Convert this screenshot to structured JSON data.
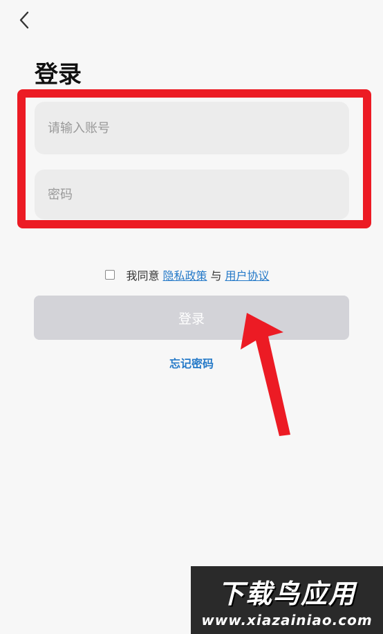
{
  "header": {
    "back_icon": "chevron-left-icon",
    "title": "登录"
  },
  "form": {
    "account_placeholder": "请输入账号",
    "password_placeholder": "密码"
  },
  "agreement": {
    "prefix": "我同意",
    "privacy_link": "隐私政策",
    "connector": "与",
    "terms_link": "用户协议"
  },
  "actions": {
    "login_label": "登录",
    "forgot_password": "忘记密码"
  },
  "watermark": {
    "title": "下载鸟应用",
    "url": "www.xiazainiao.com"
  },
  "colors": {
    "highlight": "#ec1b24",
    "link": "#2479c8",
    "button_disabled": "#d3d3d8",
    "field_bg": "#ececec"
  }
}
